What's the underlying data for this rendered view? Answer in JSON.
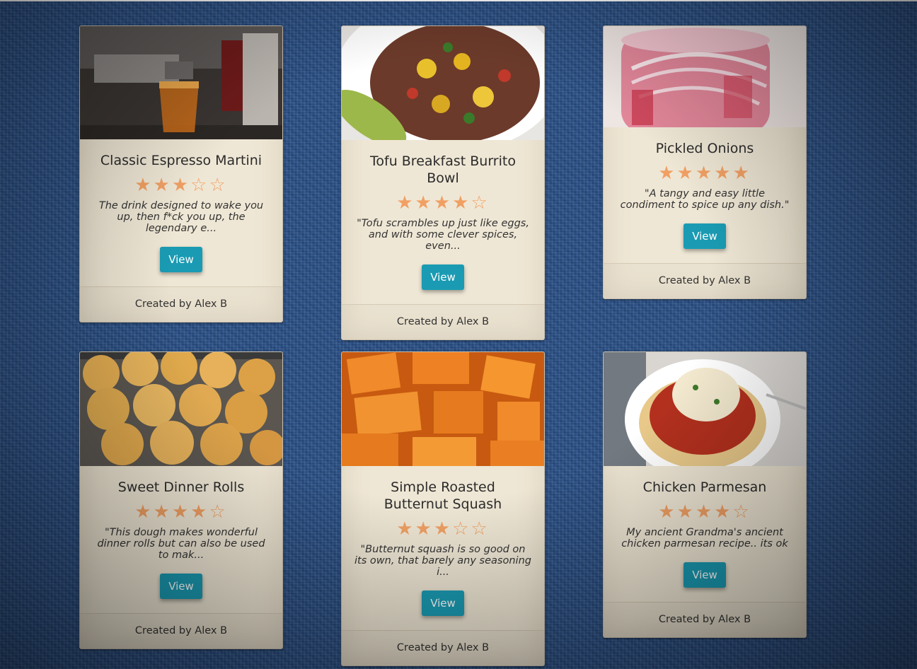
{
  "recipes": [
    {
      "title": "Classic Espresso Martini",
      "rating": 3,
      "stars": "★★★☆☆",
      "description": "The drink designed to wake you up, then f*ck you up, the legendary e...",
      "button_label": "View",
      "footer": "Created by Alex B",
      "image": "espresso-martini-photo"
    },
    {
      "title": "Tofu Breakfast Burrito Bowl",
      "rating": 4,
      "stars": "★★★★☆",
      "description": "\"Tofu scrambles up just like eggs, and with some clever spices, even...",
      "button_label": "View",
      "footer": "Created by Alex B",
      "image": "burrito-bowl-photo"
    },
    {
      "title": "Pickled Onions",
      "rating": 5,
      "stars": "★★★★★",
      "description": "\"A tangy and easy little condiment to spice up any dish.\"",
      "button_label": "View",
      "footer": "Created by Alex B",
      "image": "pickled-onions-photo"
    },
    {
      "title": "Sweet Dinner Rolls",
      "rating": 4,
      "stars": "★★★★☆",
      "description": "\"This dough makes wonderful dinner rolls but can also be used to mak...",
      "button_label": "View",
      "footer": "Created by Alex B",
      "image": "dinner-rolls-photo"
    },
    {
      "title": "Simple Roasted Butternut Squash",
      "rating": 3,
      "stars": "★★★☆☆",
      "description": "\"Butternut squash is so good on its own, that barely any seasoning i...",
      "button_label": "View",
      "footer": "Created by Alex B",
      "image": "butternut-squash-photo"
    },
    {
      "title": "Chicken Parmesan",
      "rating": 4,
      "stars": "★★★★☆",
      "description": "My ancient Grandma's ancient chicken parmesan recipe.. its ok",
      "button_label": "View",
      "footer": "Created by Alex B",
      "image": "chicken-parmesan-photo"
    }
  ],
  "colors": {
    "background": "#2a5189",
    "card": "#efe7d5",
    "star": "#f1a064",
    "button": "#1a9bb3"
  }
}
